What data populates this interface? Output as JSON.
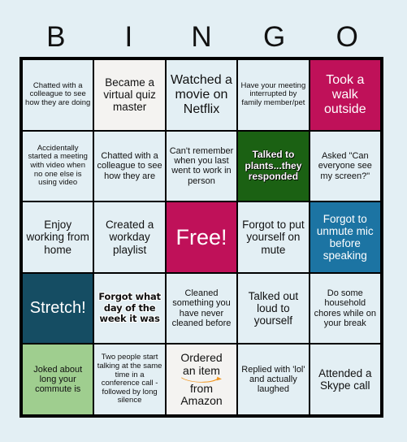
{
  "header": {
    "letters": [
      "B",
      "I",
      "N",
      "G",
      "O"
    ]
  },
  "colors": {
    "page_background": "#e3eff4",
    "cell_light_blue": "#e3eff4",
    "cell_off_white": "#f4f3f1",
    "magenta": "#bf1159",
    "dark_green": "#1b6113",
    "blue": "#1c74a3",
    "dark_teal": "#154d63",
    "light_green": "#9fce8f",
    "amazon_orange": "#f0951e",
    "border": "#000000",
    "text_dark": "#111111",
    "text_light": "#ffffff"
  },
  "grid": {
    "rows": 5,
    "columns": 5,
    "cells": [
      {
        "text": "Chatted with a colleague to see how they are doing",
        "bg": "light-blue",
        "fg": "dark",
        "size": "xs",
        "style": "plain"
      },
      {
        "text": "Became a virtual quiz master",
        "bg": "off-white",
        "fg": "dark",
        "size": "m",
        "style": "plain"
      },
      {
        "text": "Watched a movie on Netflix",
        "bg": "light-blue",
        "fg": "dark",
        "size": "l",
        "style": "plain"
      },
      {
        "text": "Have your meeting interrupted by family member/pet",
        "bg": "light-blue",
        "fg": "dark",
        "size": "xs",
        "style": "plain"
      },
      {
        "text": "Took a walk outside",
        "bg": "magenta",
        "fg": "white",
        "size": "l",
        "style": "plain"
      },
      {
        "text": "Accidentally started a meeting with video when no one else is using video",
        "bg": "light-blue",
        "fg": "dark",
        "size": "xs",
        "style": "plain"
      },
      {
        "text": "Chatted with a colleague to see how they are",
        "bg": "light-blue",
        "fg": "dark",
        "size": "s",
        "style": "plain"
      },
      {
        "text": "Can't remember when you last went to work in person",
        "bg": "light-blue",
        "fg": "dark",
        "size": "s",
        "style": "plain"
      },
      {
        "text": "Talked to plants...they responded",
        "bg": "dark-green",
        "fg": "white",
        "size": "s",
        "style": "green-outline"
      },
      {
        "text": "Asked \"Can everyone see my screen?\"",
        "bg": "light-blue",
        "fg": "dark",
        "size": "s",
        "style": "plain"
      },
      {
        "text": "Enjoy working from home",
        "bg": "light-blue",
        "fg": "dark",
        "size": "m",
        "style": "plain"
      },
      {
        "text": "Created a workday playlist",
        "bg": "light-blue",
        "fg": "dark",
        "size": "m",
        "style": "plain"
      },
      {
        "text": "Free!",
        "bg": "magenta",
        "fg": "white",
        "size": "free",
        "style": "plain"
      },
      {
        "text": "Forgot to put yourself on mute",
        "bg": "light-blue",
        "fg": "dark",
        "size": "m",
        "style": "plain"
      },
      {
        "text": "Forgot to unmute mic before speaking",
        "bg": "blue",
        "fg": "white",
        "size": "m",
        "style": "plain"
      },
      {
        "text": "Stretch!",
        "bg": "dark-teal",
        "fg": "white",
        "size": "xl",
        "style": "plain"
      },
      {
        "text": "Forgot what day of the week it was",
        "bg": "light-blue",
        "fg": "dark",
        "size": "s",
        "style": "styled-outline"
      },
      {
        "text": "Cleaned something you have never cleaned before",
        "bg": "light-blue",
        "fg": "dark",
        "size": "s",
        "style": "plain"
      },
      {
        "text": "Talked out loud to yourself",
        "bg": "light-blue",
        "fg": "dark",
        "size": "m",
        "style": "plain"
      },
      {
        "text": "Do some household chores while on your break",
        "bg": "light-blue",
        "fg": "dark",
        "size": "s",
        "style": "plain"
      },
      {
        "text": "Joked about long your commute is",
        "bg": "light-green",
        "fg": "dark",
        "size": "s",
        "style": "plain"
      },
      {
        "text": "Two people start talking at the same time in a conference call - followed by long silence",
        "bg": "light-blue",
        "fg": "dark",
        "size": "xs",
        "style": "plain"
      },
      {
        "text": "Ordered an item from Amazon",
        "bg": "off-white",
        "fg": "dark",
        "size": "m",
        "style": "amazon",
        "amazon_lines": [
          "Ordered",
          "an item",
          "from",
          "Amazon"
        ]
      },
      {
        "text": "Replied with 'lol' and actually laughed",
        "bg": "light-blue",
        "fg": "dark",
        "size": "s",
        "style": "plain"
      },
      {
        "text": "Attended a Skype call",
        "bg": "light-blue",
        "fg": "dark",
        "size": "m",
        "style": "plain"
      }
    ]
  }
}
